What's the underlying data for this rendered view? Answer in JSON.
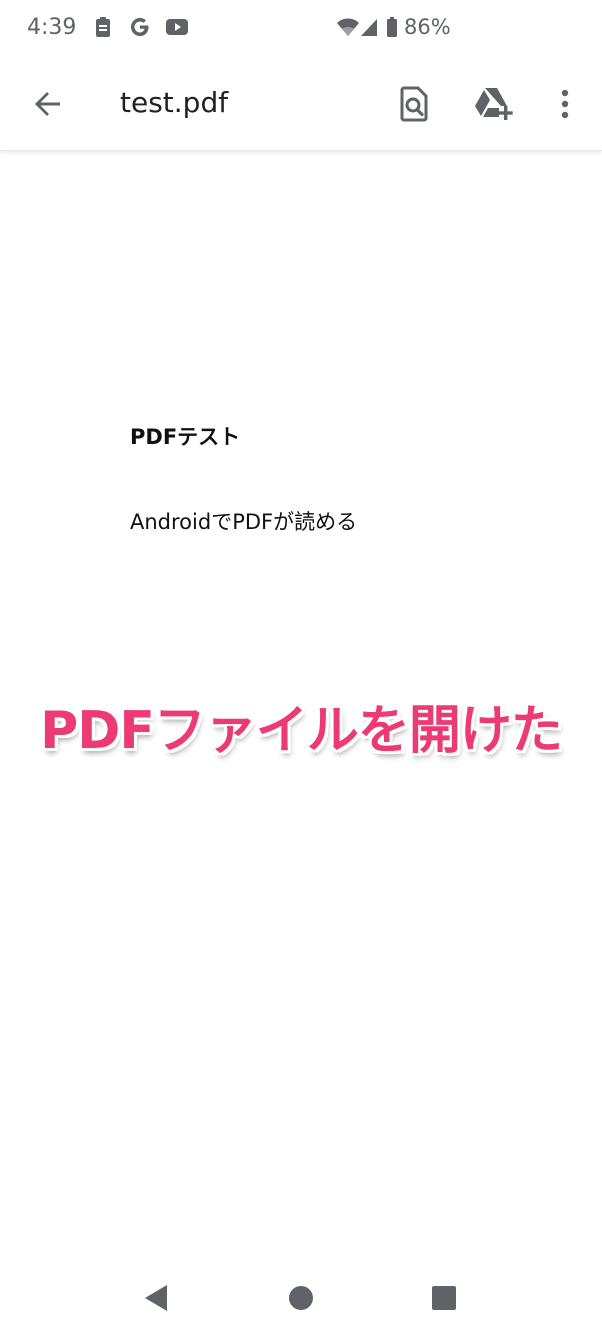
{
  "status_bar": {
    "time": "4:39",
    "battery_percent": "86%",
    "icons": [
      "clipboard-icon",
      "google-g-icon",
      "youtube-icon",
      "wifi-icon",
      "signal-icon",
      "battery-icon"
    ]
  },
  "app_bar": {
    "title": "test.pdf",
    "actions": [
      "find-in-page-icon",
      "add-to-drive-icon",
      "more-vert-icon"
    ]
  },
  "document": {
    "heading": "PDFテスト",
    "body": "AndroidでPDFが読める"
  },
  "caption": {
    "text": "PDFファイルを開けた",
    "color": "#ec3a73"
  },
  "nav_bar": {
    "buttons": [
      "back-triangle-icon",
      "home-circle-icon",
      "recents-square-icon"
    ]
  }
}
